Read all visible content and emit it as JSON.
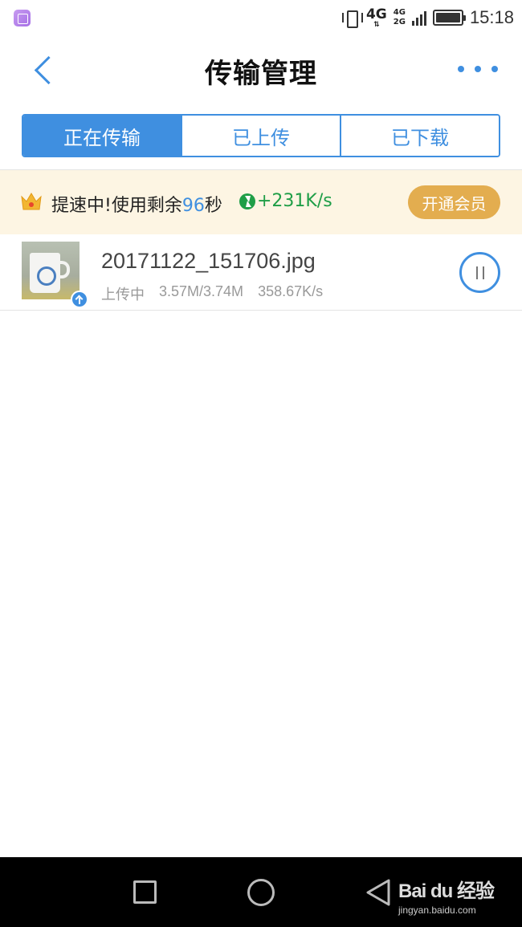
{
  "status_bar": {
    "network": "4G",
    "dual_sim": [
      "4G",
      "2G"
    ],
    "time": "15:18"
  },
  "header": {
    "title": "传输管理"
  },
  "tabs": [
    {
      "label": "正在传输",
      "active": true
    },
    {
      "label": "已上传",
      "active": false
    },
    {
      "label": "已下载",
      "active": false
    }
  ],
  "promo": {
    "text_before": "提速中!使用剩余",
    "seconds": "96",
    "text_after": "秒",
    "speed_boost": "+231K/s",
    "vip_button": "开通会员"
  },
  "transfers": [
    {
      "filename": "20171122_151706.jpg",
      "status": "上传中",
      "progress": "3.57M/3.74M",
      "speed": "358.67K/s"
    }
  ],
  "watermark": {
    "logo": "Bai du 经验",
    "url": "jingyan.baidu.com"
  },
  "colors": {
    "accent": "#3f8fe0",
    "promo_bg": "#fdf5e3",
    "vip": "#e3ad4f",
    "boost": "#1f9e47"
  }
}
